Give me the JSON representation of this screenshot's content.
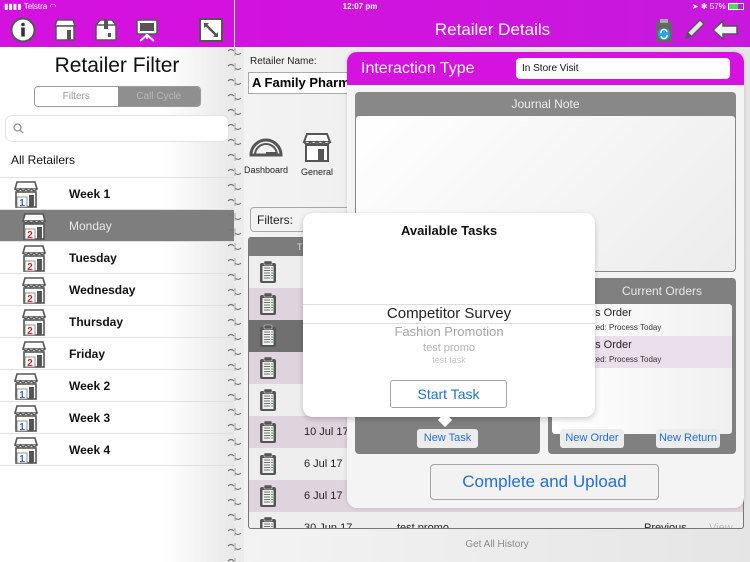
{
  "status_bar": {
    "carrier": "Telstra",
    "time": "12:07 pm",
    "battery": "57%"
  },
  "left_toolbar": {
    "icons": [
      "info-icon",
      "store-icon",
      "package-icon",
      "presentation-icon",
      "expand-icon"
    ]
  },
  "header": {
    "title": "Retailer Details",
    "icons": [
      "sync-clipboard-icon",
      "pencil-icon",
      "back-arrow-icon"
    ]
  },
  "sidebar": {
    "title": "Retailer Filter",
    "segments": [
      {
        "label": "Filters",
        "selected": false
      },
      {
        "label": "Call Cycle",
        "selected": true
      }
    ],
    "search": {
      "placeholder": "",
      "value": ""
    },
    "all_label": "All Retailers",
    "items": [
      {
        "label": "Week 1",
        "badge": "1",
        "level": "week",
        "selected": false
      },
      {
        "label": "Monday",
        "badge": "2",
        "level": "day",
        "selected": true
      },
      {
        "label": "Tuesday",
        "badge": "2",
        "level": "day",
        "selected": false
      },
      {
        "label": "Wednesday",
        "badge": "2",
        "level": "day",
        "selected": false
      },
      {
        "label": "Thursday",
        "badge": "2",
        "level": "day",
        "selected": false
      },
      {
        "label": "Friday",
        "badge": "2",
        "level": "day",
        "selected": false
      },
      {
        "label": "Week 2",
        "badge": "1",
        "level": "week",
        "selected": false
      },
      {
        "label": "Week 3",
        "badge": "1",
        "level": "week",
        "selected": false
      },
      {
        "label": "Week 4",
        "badge": "1",
        "level": "week",
        "selected": false
      }
    ]
  },
  "main": {
    "retailer_name_label": "Retailer Name:",
    "retailer_name": "A Family Pharmacy",
    "nav": [
      {
        "label": "Dashboard",
        "icon": "gauge-icon"
      },
      {
        "label": "General",
        "icon": "store-icon"
      }
    ],
    "filters_label": "Filters:",
    "history_header": "T",
    "history_rows": [
      {
        "date": "",
        "style": "normal"
      },
      {
        "date": "",
        "style": "alt"
      },
      {
        "date": "",
        "style": "selected"
      },
      {
        "date": "",
        "style": "alt"
      },
      {
        "date": "",
        "style": "normal"
      },
      {
        "date": "10 Jul 17",
        "style": "alt"
      },
      {
        "date": "6 Jul 17",
        "style": "normal"
      },
      {
        "date": "6 Jul 17",
        "style": "alt"
      },
      {
        "date": "30 Jun 17",
        "task": "test promo",
        "type": "Previous",
        "action": "View",
        "style": "normal"
      }
    ],
    "get_all_history": "Get All History"
  },
  "interaction": {
    "title": "Interaction Type",
    "type_value": "In Store Visit",
    "journal_label": "Journal Note",
    "journal_value": "",
    "new_task_label": "New Task",
    "orders_label": "Current Orders",
    "orders": [
      {
        "title": "es Order",
        "subtitle": "ated: Process Today"
      },
      {
        "title": "es Order",
        "subtitle": "ated: Process Today"
      }
    ],
    "new_order_label": "New Order",
    "new_return_label": "New Return",
    "complete_label": "Complete and Upload"
  },
  "available_tasks": {
    "title": "Available Tasks",
    "options": [
      "Competitor Survey",
      "Fashion Promotion",
      "test promo",
      "test task"
    ],
    "selected": "Competitor Survey",
    "start_label": "Start Task"
  },
  "colors": {
    "brand": "#d312df",
    "link": "#1f6fd6",
    "selected_row": "#7e7e7e",
    "alt_row": "#dfd3de"
  }
}
